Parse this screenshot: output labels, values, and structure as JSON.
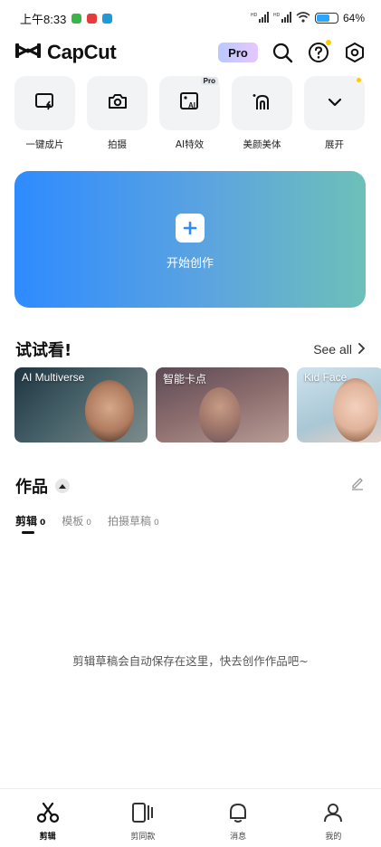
{
  "status_bar": {
    "time": "上午8:33",
    "network_hd1": "HD",
    "network_hd2": "HD",
    "battery_text": "64%",
    "battery_level": 0.64,
    "app_icon_colors": [
      "#39b54a",
      "#e63b3b",
      "#1e9bd7"
    ]
  },
  "header": {
    "app_name": "CapCut",
    "pro_label": "Pro",
    "icons": [
      "capcut-logo-icon",
      "search-icon",
      "help-icon",
      "settings-icon"
    ],
    "accent_dot_color": "#ffcc00"
  },
  "quick_tools": [
    {
      "label": "一键成片",
      "icon": "auto-cut-icon"
    },
    {
      "label": "拍摄",
      "icon": "camera-icon"
    },
    {
      "label": "AI特效",
      "icon": "ai-effects-icon",
      "badge": "Pro"
    },
    {
      "label": "美颜美体",
      "icon": "beauty-icon"
    },
    {
      "label": "展开",
      "icon": "chevron-down-icon"
    }
  ],
  "create": {
    "label": "开始创作",
    "gradient": [
      "#2e8bff",
      "#6cc0b8"
    ]
  },
  "try_section": {
    "title": "试试看!",
    "see_all": "See all",
    "cards": [
      {
        "title": "AI Multiverse"
      },
      {
        "title": "智能卡点"
      },
      {
        "title": "Kid Face"
      }
    ]
  },
  "works": {
    "title": "作品",
    "tabs": [
      {
        "label": "剪辑",
        "count": "0",
        "active": true
      },
      {
        "label": "模板",
        "count": "0",
        "active": false
      },
      {
        "label": "拍摄草稿",
        "count": "0",
        "active": false
      }
    ],
    "empty_message": "剪辑草稿会自动保存在这里，快去创作作品吧~"
  },
  "bottom_nav": [
    {
      "label": "剪辑",
      "icon": "scissors-icon",
      "active": true
    },
    {
      "label": "剪同款",
      "icon": "template-icon",
      "active": false
    },
    {
      "label": "消息",
      "icon": "bell-icon",
      "active": false
    },
    {
      "label": "我的",
      "icon": "profile-icon",
      "active": false
    }
  ]
}
